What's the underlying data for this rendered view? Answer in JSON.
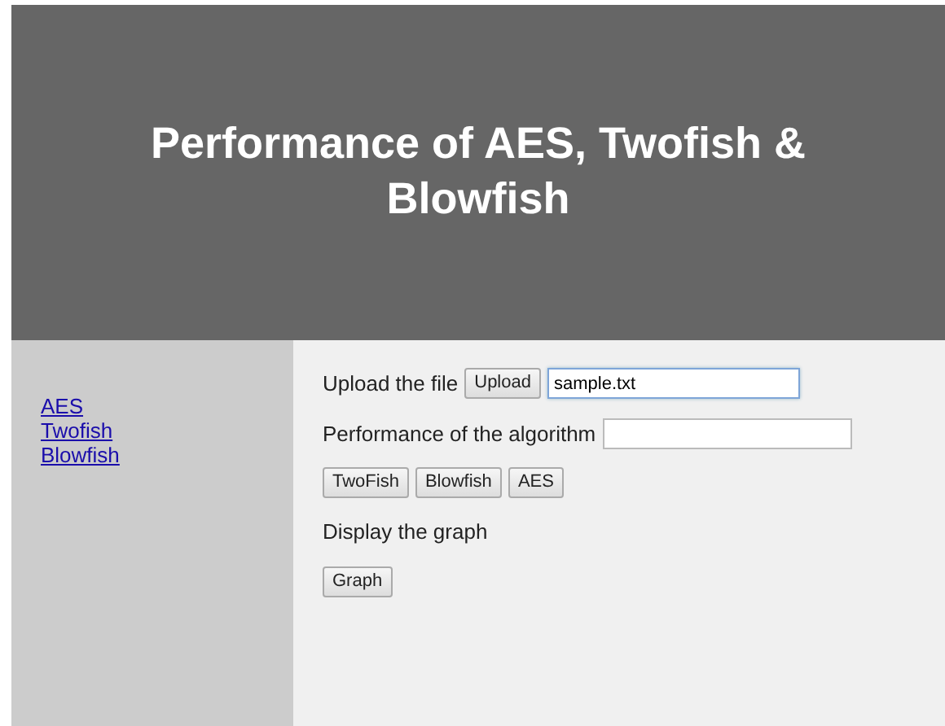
{
  "header": {
    "title": "Performance of AES, Twofish & Blowfish"
  },
  "sidebar": {
    "links": [
      "AES",
      "Twofish",
      "Blowfish"
    ]
  },
  "upload": {
    "label": "Upload the file",
    "button": "Upload",
    "value": "sample.txt",
    "focused": true
  },
  "performance": {
    "label": "Performance of the algorithm",
    "focused": false
  },
  "algorithm_buttons": [
    "TwoFish",
    "Blowfish",
    "AES"
  ],
  "graph": {
    "label": "Display the graph",
    "button": "Graph"
  }
}
